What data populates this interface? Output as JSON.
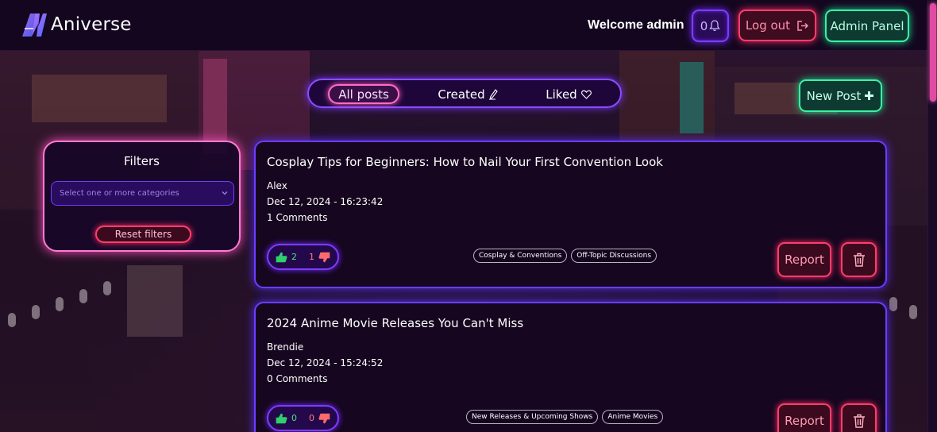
{
  "colors": {
    "accent_purple": "#7d3cff",
    "accent_pink": "#ff6ec7",
    "accent_green": "#3cf0a4",
    "accent_red": "#ff3d6e",
    "page_bg": "#14061f"
  },
  "header": {
    "logo_text": "Aniverse",
    "logo_icon": "aniverse-logo-icon",
    "welcome": "Welcome admin",
    "notifications": {
      "count": "0",
      "icon": "bell-icon"
    },
    "logout_label": "Log out",
    "logout_icon": "logout-icon",
    "admin_panel_label": "Admin Panel"
  },
  "tabs": [
    {
      "label": "All posts",
      "active": true
    },
    {
      "label": "Created",
      "icon": "pencil-icon",
      "active": false
    },
    {
      "label": "Liked",
      "icon": "heart-icon",
      "active": false
    }
  ],
  "new_post": {
    "label": "New Post",
    "icon": "plus-icon"
  },
  "filters": {
    "title": "Filters",
    "category_placeholder": "Select one or more categories",
    "reset_label": "Reset filters"
  },
  "posts": [
    {
      "title": "Cosplay Tips for Beginners: How to Nail Your First Convention Look",
      "author": "Alex",
      "date": "Dec 12, 2024 - 16:23:42",
      "comments": "1 Comments",
      "likes": "2",
      "dislikes": "1",
      "tags": [
        "Cosplay & Conventions",
        "Off-Topic Discussions"
      ],
      "report_label": "Report"
    },
    {
      "title": "2024 Anime Movie Releases You Can't Miss",
      "author": "Brendie",
      "date": "Dec 12, 2024 - 15:24:52",
      "comments": "0 Comments",
      "likes": "0",
      "dislikes": "0",
      "tags": [
        "New Releases & Upcoming Shows",
        "Anime Movies"
      ],
      "report_label": "Report"
    }
  ]
}
